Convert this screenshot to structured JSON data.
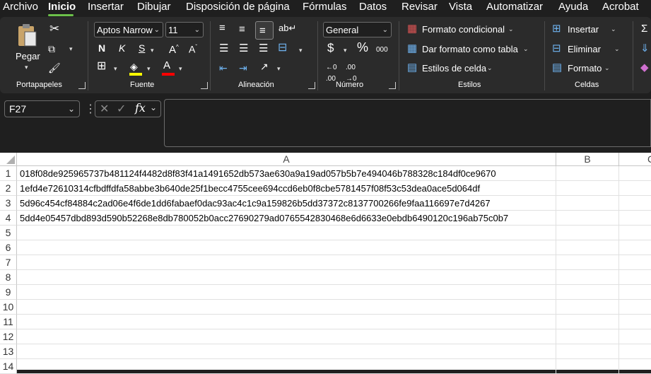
{
  "menu": {
    "items": [
      "Archivo",
      "Inicio",
      "Insertar",
      "Dibujar",
      "Disposición de página",
      "Fórmulas",
      "Datos",
      "Revisar",
      "Vista",
      "Automatizar",
      "Ayuda",
      "Acrobat"
    ],
    "active": "Inicio"
  },
  "ribbon": {
    "clipboard": {
      "paste_label": "Pegar",
      "group_label": "Portapapeles"
    },
    "font": {
      "name": "Aptos Narrow",
      "size": "11",
      "bold": "N",
      "italic": "K",
      "underline": "S",
      "group_label": "Fuente"
    },
    "alignment": {
      "group_label": "Alineación"
    },
    "number": {
      "format": "General",
      "group_label": "Número"
    },
    "styles": {
      "conditional": "Formato condicional",
      "as_table": "Dar formato como tabla",
      "cell_styles": "Estilos de celda",
      "group_label": "Estilos"
    },
    "cells": {
      "insert": "Insertar",
      "delete": "Eliminar",
      "format": "Formato",
      "group_label": "Celdas"
    }
  },
  "formula_bar": {
    "name_box": "F27",
    "content": ""
  },
  "sheet": {
    "columns": [
      "A",
      "B",
      "C"
    ],
    "rows": [
      "1",
      "2",
      "3",
      "4",
      "5",
      "6",
      "7",
      "8",
      "9",
      "10",
      "11",
      "12",
      "13",
      "14"
    ],
    "cells": [
      "018f08de925965737b481124f4482d8f83f41a1491652db573ae630a9a19ad057b5b7e494046b788328c184df0ce9670",
      "1efd4e72610314cfbdffdfa58abbe3b640de25f1becc4755cee694ccd6eb0f8cbe5781457f08f53c53dea0ace5d064df",
      "5d96c454cf84884c2ad06e4f6de1dd6fabaef0dac93ac4c1c9a159826b5dd37372c8137700266fe9faa116697e7d4267",
      "5dd4e05457dbd893d590b52268e8db780052b0acc27690279ad0765542830468e6d6633e0ebdb6490120c196ab75c0b7"
    ]
  },
  "colors": {
    "accent": "#6cc04a",
    "ribbon": "#2b2b2b",
    "window": "#1f1f1f",
    "fill_yellow": "#ffff00",
    "font_red": "#ff0000"
  }
}
